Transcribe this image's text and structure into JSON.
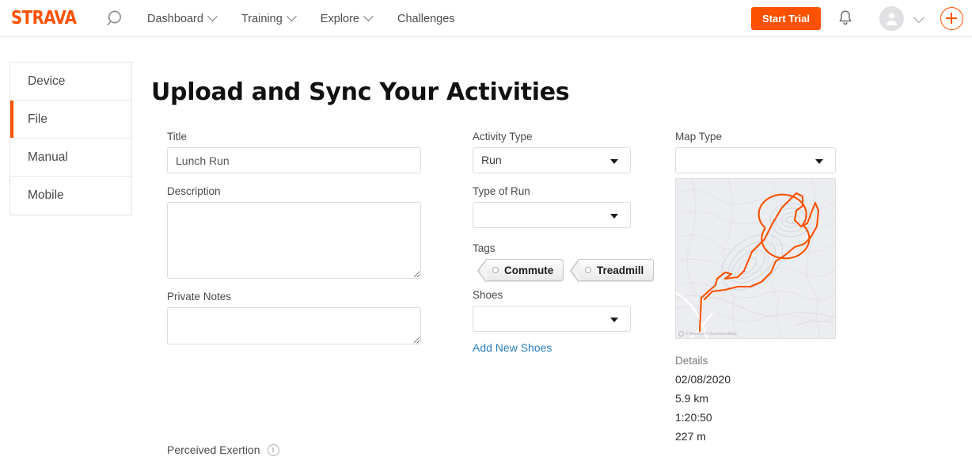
{
  "brand": {
    "name": "STRAVA",
    "accent": "#fc5200",
    "link_color": "#2a7fc2"
  },
  "header": {
    "search_icon": "search-icon",
    "nav": [
      {
        "label": "Dashboard",
        "has_caret": true
      },
      {
        "label": "Training",
        "has_caret": true
      },
      {
        "label": "Explore",
        "has_caret": true
      },
      {
        "label": "Challenges",
        "has_caret": false
      }
    ],
    "trial_button": "Start Trial",
    "bell_icon": "notification-bell-icon",
    "avatar_icon": "user-avatar-icon",
    "avatar_caret": "chevron-down-icon",
    "add_icon": "plus-circle-icon"
  },
  "sidebar": {
    "items": [
      {
        "label": "Device",
        "active": false
      },
      {
        "label": "File",
        "active": true
      },
      {
        "label": "Manual",
        "active": false
      },
      {
        "label": "Mobile",
        "active": false
      }
    ]
  },
  "main": {
    "title": "Upload and Sync Your Activities",
    "form": {
      "title_label": "Title",
      "title_value": "Lunch Run",
      "description_label": "Description",
      "description_value": "",
      "private_notes_label": "Private Notes",
      "private_notes_value": "",
      "activity_type_label": "Activity Type",
      "activity_type_value": "Run",
      "type_of_run_label": "Type of Run",
      "type_of_run_value": "",
      "tags_label": "Tags",
      "tags": [
        {
          "label": "Commute",
          "selected": false
        },
        {
          "label": "Treadmill",
          "selected": false
        }
      ],
      "shoes_label": "Shoes",
      "shoes_value": "",
      "add_new_shoes": "Add New Shoes",
      "map_type_label": "Map Type",
      "map_type_value": "",
      "perceived_exertion_label": "Perceived Exertion",
      "perceived_exertion_info": "i"
    },
    "map": {
      "attribution": "© Mapbox © OpenStreetMap",
      "route_color": "#fc5200"
    },
    "details": {
      "heading": "Details",
      "date": "02/08/2020",
      "distance": "5.9 km",
      "time": "1:20:50",
      "elevation": "227 m"
    }
  }
}
